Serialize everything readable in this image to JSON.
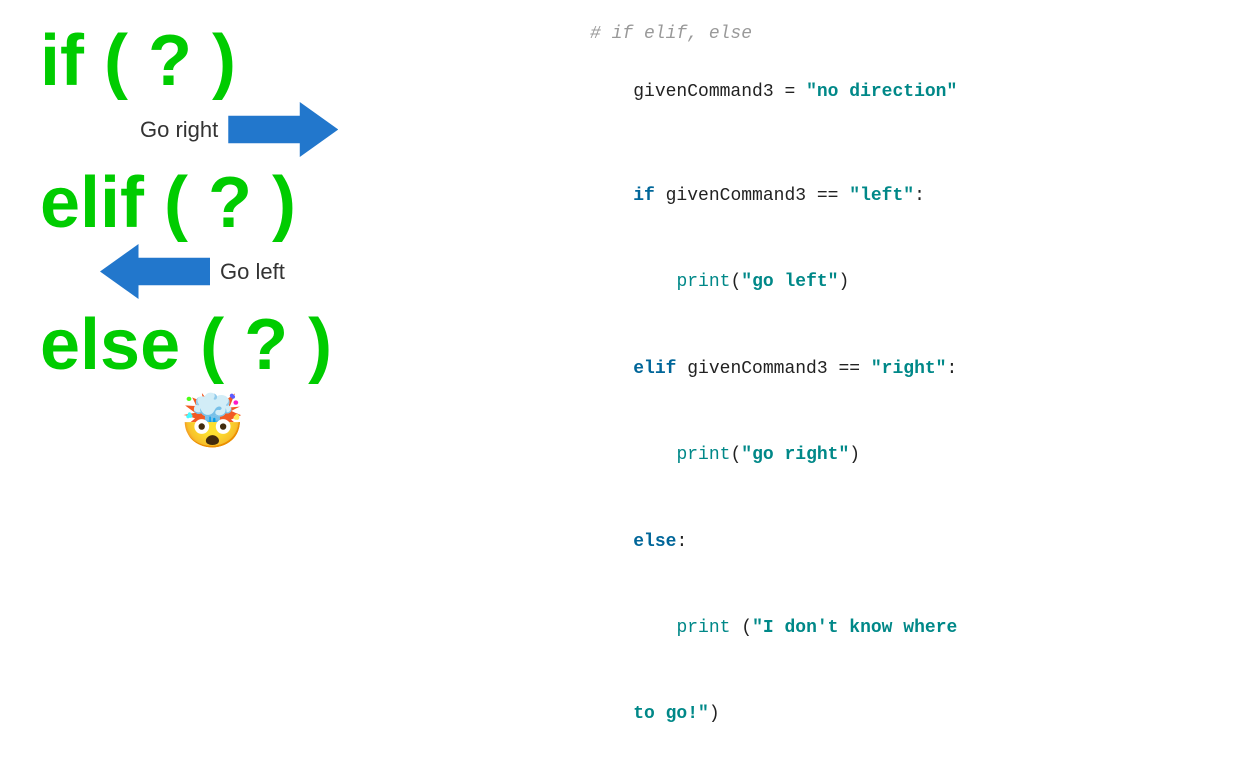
{
  "left": {
    "if_label": "if ( ? )",
    "go_right_label": "Go right",
    "elif_label": "elif ( ? )",
    "go_left_label": "Go left",
    "else_label": "else ( ? )",
    "emoji": "🤯"
  },
  "right": {
    "comment": "# if elif, else",
    "line1_var": "givenCommand3",
    "line1_eq": " = ",
    "line1_val": "\"no direction\"",
    "blank": "",
    "if_kw": "if",
    "if_cond": " givenCommand3 == ",
    "if_val": "\"left\"",
    "if_colon": ":",
    "print1": "    print(",
    "print1_val": "\"go left\"",
    "print1_close": ")",
    "elif_kw": "elif",
    "elif_cond": " givenCommand3 == ",
    "elif_val": "\"right\"",
    "elif_colon": ":",
    "print2": "    print(",
    "print2_val": "\"go right\"",
    "print2_close": ")",
    "else_kw": "else",
    "else_colon": ":",
    "print3a": "    print (",
    "print3_val": "\"I don't know where",
    "print3b": "to go!\"",
    "print3_close": ")"
  }
}
